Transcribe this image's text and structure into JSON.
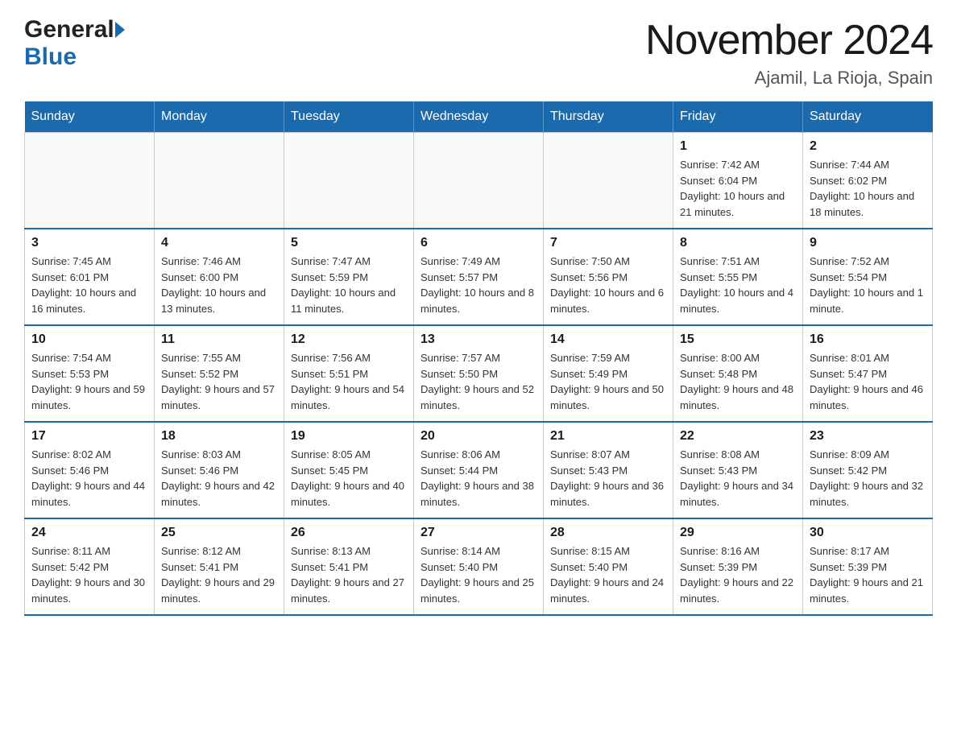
{
  "header": {
    "logo_general": "General",
    "logo_blue": "Blue",
    "month_title": "November 2024",
    "location": "Ajamil, La Rioja, Spain"
  },
  "days_of_week": [
    "Sunday",
    "Monday",
    "Tuesday",
    "Wednesday",
    "Thursday",
    "Friday",
    "Saturday"
  ],
  "weeks": [
    [
      {
        "day": "",
        "sunrise": "",
        "sunset": "",
        "daylight": ""
      },
      {
        "day": "",
        "sunrise": "",
        "sunset": "",
        "daylight": ""
      },
      {
        "day": "",
        "sunrise": "",
        "sunset": "",
        "daylight": ""
      },
      {
        "day": "",
        "sunrise": "",
        "sunset": "",
        "daylight": ""
      },
      {
        "day": "",
        "sunrise": "",
        "sunset": "",
        "daylight": ""
      },
      {
        "day": "1",
        "sunrise": "Sunrise: 7:42 AM",
        "sunset": "Sunset: 6:04 PM",
        "daylight": "Daylight: 10 hours and 21 minutes."
      },
      {
        "day": "2",
        "sunrise": "Sunrise: 7:44 AM",
        "sunset": "Sunset: 6:02 PM",
        "daylight": "Daylight: 10 hours and 18 minutes."
      }
    ],
    [
      {
        "day": "3",
        "sunrise": "Sunrise: 7:45 AM",
        "sunset": "Sunset: 6:01 PM",
        "daylight": "Daylight: 10 hours and 16 minutes."
      },
      {
        "day": "4",
        "sunrise": "Sunrise: 7:46 AM",
        "sunset": "Sunset: 6:00 PM",
        "daylight": "Daylight: 10 hours and 13 minutes."
      },
      {
        "day": "5",
        "sunrise": "Sunrise: 7:47 AM",
        "sunset": "Sunset: 5:59 PM",
        "daylight": "Daylight: 10 hours and 11 minutes."
      },
      {
        "day": "6",
        "sunrise": "Sunrise: 7:49 AM",
        "sunset": "Sunset: 5:57 PM",
        "daylight": "Daylight: 10 hours and 8 minutes."
      },
      {
        "day": "7",
        "sunrise": "Sunrise: 7:50 AM",
        "sunset": "Sunset: 5:56 PM",
        "daylight": "Daylight: 10 hours and 6 minutes."
      },
      {
        "day": "8",
        "sunrise": "Sunrise: 7:51 AM",
        "sunset": "Sunset: 5:55 PM",
        "daylight": "Daylight: 10 hours and 4 minutes."
      },
      {
        "day": "9",
        "sunrise": "Sunrise: 7:52 AM",
        "sunset": "Sunset: 5:54 PM",
        "daylight": "Daylight: 10 hours and 1 minute."
      }
    ],
    [
      {
        "day": "10",
        "sunrise": "Sunrise: 7:54 AM",
        "sunset": "Sunset: 5:53 PM",
        "daylight": "Daylight: 9 hours and 59 minutes."
      },
      {
        "day": "11",
        "sunrise": "Sunrise: 7:55 AM",
        "sunset": "Sunset: 5:52 PM",
        "daylight": "Daylight: 9 hours and 57 minutes."
      },
      {
        "day": "12",
        "sunrise": "Sunrise: 7:56 AM",
        "sunset": "Sunset: 5:51 PM",
        "daylight": "Daylight: 9 hours and 54 minutes."
      },
      {
        "day": "13",
        "sunrise": "Sunrise: 7:57 AM",
        "sunset": "Sunset: 5:50 PM",
        "daylight": "Daylight: 9 hours and 52 minutes."
      },
      {
        "day": "14",
        "sunrise": "Sunrise: 7:59 AM",
        "sunset": "Sunset: 5:49 PM",
        "daylight": "Daylight: 9 hours and 50 minutes."
      },
      {
        "day": "15",
        "sunrise": "Sunrise: 8:00 AM",
        "sunset": "Sunset: 5:48 PM",
        "daylight": "Daylight: 9 hours and 48 minutes."
      },
      {
        "day": "16",
        "sunrise": "Sunrise: 8:01 AM",
        "sunset": "Sunset: 5:47 PM",
        "daylight": "Daylight: 9 hours and 46 minutes."
      }
    ],
    [
      {
        "day": "17",
        "sunrise": "Sunrise: 8:02 AM",
        "sunset": "Sunset: 5:46 PM",
        "daylight": "Daylight: 9 hours and 44 minutes."
      },
      {
        "day": "18",
        "sunrise": "Sunrise: 8:03 AM",
        "sunset": "Sunset: 5:46 PM",
        "daylight": "Daylight: 9 hours and 42 minutes."
      },
      {
        "day": "19",
        "sunrise": "Sunrise: 8:05 AM",
        "sunset": "Sunset: 5:45 PM",
        "daylight": "Daylight: 9 hours and 40 minutes."
      },
      {
        "day": "20",
        "sunrise": "Sunrise: 8:06 AM",
        "sunset": "Sunset: 5:44 PM",
        "daylight": "Daylight: 9 hours and 38 minutes."
      },
      {
        "day": "21",
        "sunrise": "Sunrise: 8:07 AM",
        "sunset": "Sunset: 5:43 PM",
        "daylight": "Daylight: 9 hours and 36 minutes."
      },
      {
        "day": "22",
        "sunrise": "Sunrise: 8:08 AM",
        "sunset": "Sunset: 5:43 PM",
        "daylight": "Daylight: 9 hours and 34 minutes."
      },
      {
        "day": "23",
        "sunrise": "Sunrise: 8:09 AM",
        "sunset": "Sunset: 5:42 PM",
        "daylight": "Daylight: 9 hours and 32 minutes."
      }
    ],
    [
      {
        "day": "24",
        "sunrise": "Sunrise: 8:11 AM",
        "sunset": "Sunset: 5:42 PM",
        "daylight": "Daylight: 9 hours and 30 minutes."
      },
      {
        "day": "25",
        "sunrise": "Sunrise: 8:12 AM",
        "sunset": "Sunset: 5:41 PM",
        "daylight": "Daylight: 9 hours and 29 minutes."
      },
      {
        "day": "26",
        "sunrise": "Sunrise: 8:13 AM",
        "sunset": "Sunset: 5:41 PM",
        "daylight": "Daylight: 9 hours and 27 minutes."
      },
      {
        "day": "27",
        "sunrise": "Sunrise: 8:14 AM",
        "sunset": "Sunset: 5:40 PM",
        "daylight": "Daylight: 9 hours and 25 minutes."
      },
      {
        "day": "28",
        "sunrise": "Sunrise: 8:15 AM",
        "sunset": "Sunset: 5:40 PM",
        "daylight": "Daylight: 9 hours and 24 minutes."
      },
      {
        "day": "29",
        "sunrise": "Sunrise: 8:16 AM",
        "sunset": "Sunset: 5:39 PM",
        "daylight": "Daylight: 9 hours and 22 minutes."
      },
      {
        "day": "30",
        "sunrise": "Sunrise: 8:17 AM",
        "sunset": "Sunset: 5:39 PM",
        "daylight": "Daylight: 9 hours and 21 minutes."
      }
    ]
  ]
}
